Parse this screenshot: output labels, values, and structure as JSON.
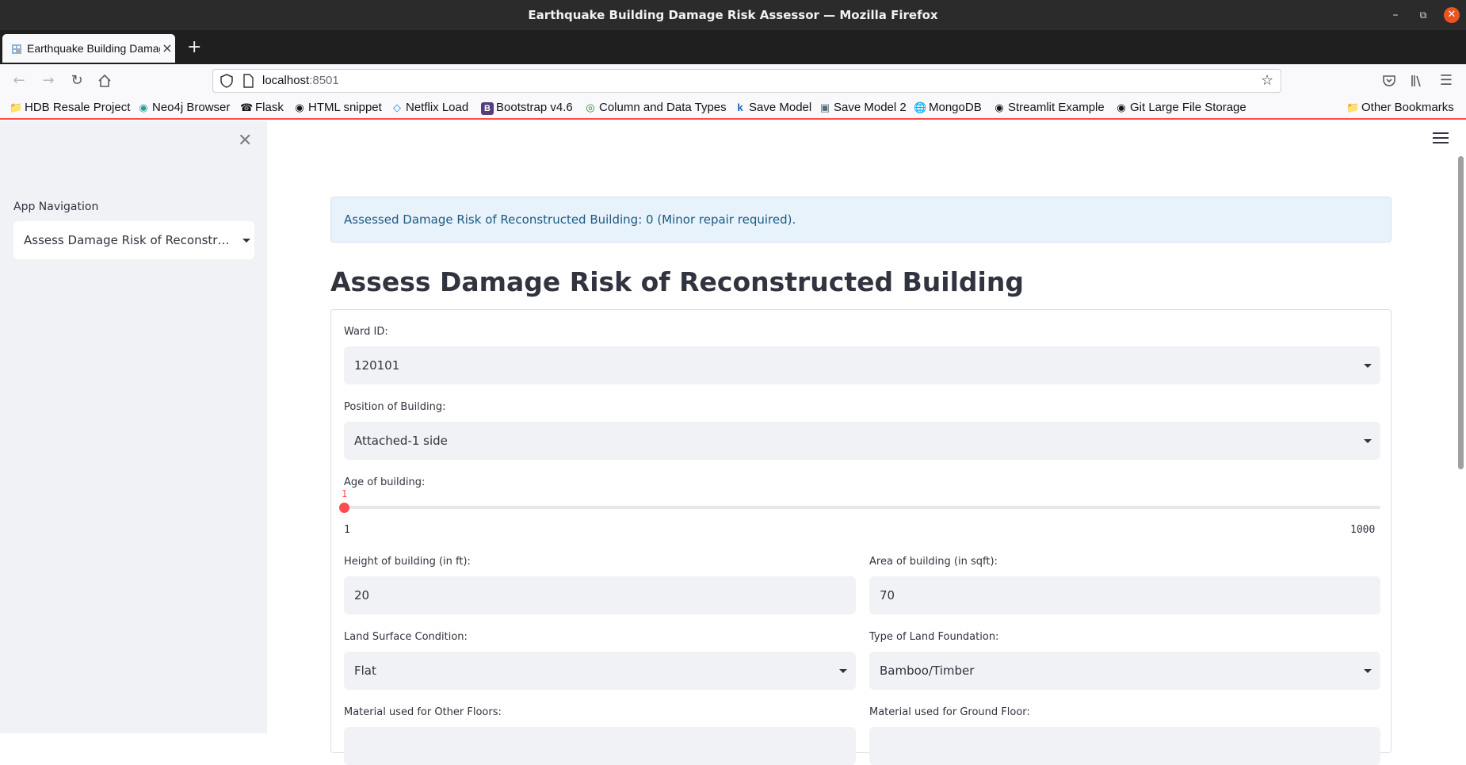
{
  "window": {
    "title": "Earthquake Building Damage Risk Assessor — Mozilla Firefox"
  },
  "tabs": [
    {
      "label": "Earthquake Building Damage Risk Assessor",
      "active": true
    }
  ],
  "navbar": {
    "url_host": "localhost",
    "url_port": ":8501"
  },
  "bookmarks": [
    {
      "label": "HDB Resale Project",
      "icon": "folder-icon"
    },
    {
      "label": "Neo4j Browser",
      "icon": "neo4j-icon"
    },
    {
      "label": "Flask",
      "icon": "flask-icon"
    },
    {
      "label": "HTML snippet",
      "icon": "github-icon"
    },
    {
      "label": "Netflix Load",
      "icon": "code-icon"
    },
    {
      "label": "Bootstrap v4.6",
      "icon": "bootstrap-icon"
    },
    {
      "label": "Column and Data Types",
      "icon": "target-icon"
    },
    {
      "label": "Save Model",
      "icon": "k-icon"
    },
    {
      "label": "Save Model 2",
      "icon": "image-icon"
    },
    {
      "label": "MongoDB",
      "icon": "globe-icon"
    },
    {
      "label": "Streamlit Example",
      "icon": "github-icon"
    },
    {
      "label": "Git Large File Storage",
      "icon": "github-icon"
    },
    {
      "label": "Other Bookmarks",
      "icon": "folder-icon"
    }
  ],
  "sidebar": {
    "nav_label": "App Navigation",
    "nav_selected": "Assess Damage Risk of Reconstructed Building"
  },
  "main": {
    "alert": "Assessed Damage Risk of Reconstructed Building: 0 (Minor repair required).",
    "title": "Assess Damage Risk of Reconstructed Building",
    "form": {
      "ward_label": "Ward ID:",
      "ward_value": "120101",
      "position_label": "Position of Building:",
      "position_value": "Attached-1 side",
      "age_label": "Age of building:",
      "age_value": "1",
      "age_min": "1",
      "age_max": "1000",
      "height_label": "Height of building (in ft):",
      "height_value": "20",
      "area_label": "Area of building (in sqft):",
      "area_value": "70",
      "land_surface_label": "Land Surface Condition:",
      "land_surface_value": "Flat",
      "foundation_label": "Type of Land Foundation:",
      "foundation_value": "Bamboo/Timber",
      "other_floors_label": "Material used for Other Floors:",
      "ground_floor_label": "Material used for Ground Floor:"
    }
  },
  "colors": {
    "accent": "#ff4b4b",
    "alert_bg": "#e8f2fb",
    "alert_text": "#1c5a82",
    "sidebar_bg": "#f0f2f6"
  }
}
